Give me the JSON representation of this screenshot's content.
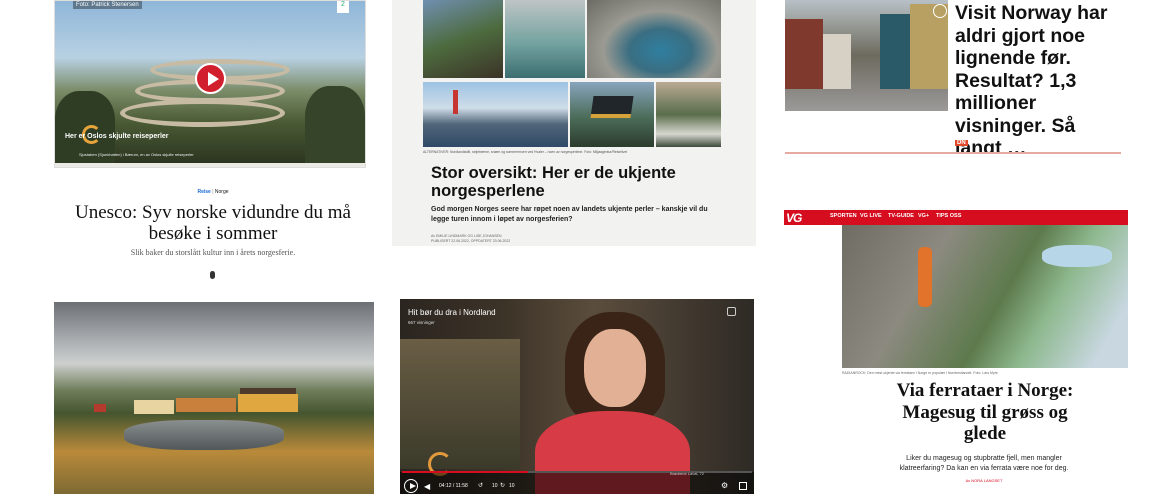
{
  "card1": {
    "photo_credit": "Foto: Patrick Stenersen",
    "corner_badge": "2",
    "video_title": "Her er Oslos skjulte reiseperler",
    "video_caption": "Sjustaben (Sjunkhatten) i Bærum, en av Oslos skjulte reiseperler",
    "section": "Reise",
    "subsection": "Norge",
    "headline": "Unesco: Syv norske vidundre du må besøke i sommer",
    "lead": "Slik baker du storslått kultur inn i årets norgesferie."
  },
  "card2": {
    "photo_caption": "ALTERNATIVER: Nordlandsbåt, seljetrærne, snøen og sommermoen ved Hvaler – noen av norgesperlene. Foto: Miljøagentur/Reiselivet",
    "headline": "Stor oversikt: Her er de ukjente norgesperlene",
    "lead": "God morgen Norges seere har røpet noen av landets ukjente perler – kanskje vil du legge turen innom i løpet av norgesferien?",
    "byline": "Av EMILIE LINDMARK  OG LISE JOHANSEN",
    "updated": "PUBLISERT 22.06.2022, OPPDATERT 23.06.2022"
  },
  "card3": {
    "headline": "Visit Norway har aldri gjort noe lignende før. Resultat? 1,3 millioner visninger. Så langt …",
    "tag": "DN"
  },
  "card4": {
    "logo": "VG",
    "nav": [
      "SPORTEN",
      "VG LIVE",
      "TV-GUIDE",
      "VG+",
      "TIPS OSS"
    ],
    "photo_caption": "RADIANROCK: Den mest ukjente via ferrataen i Norge er populær i Nordvestlandet. Foto: Lars Myhr",
    "headline": "Via ferrataer i Norge: Magesug til grøss og glede",
    "lead": "Liker du magesug og stupbratte fjell, men mangler klatreerfaring? Da kan en via ferrata være noe for deg.",
    "byline": "Av NORA LANGSET"
  },
  "card6": {
    "video_title": "Hit bør du dra i Nordland",
    "views": "667 visninger",
    "time": "04:12 / 11:58",
    "rewind": "10",
    "rate": "1x",
    "ff": "10",
    "watermark": "Brødrene Laval, 72",
    "progress": 0.36
  },
  "colors": {
    "vg_red": "#d50d1f",
    "play_red": "#d21f2e",
    "section_blue": "#1967d2"
  }
}
